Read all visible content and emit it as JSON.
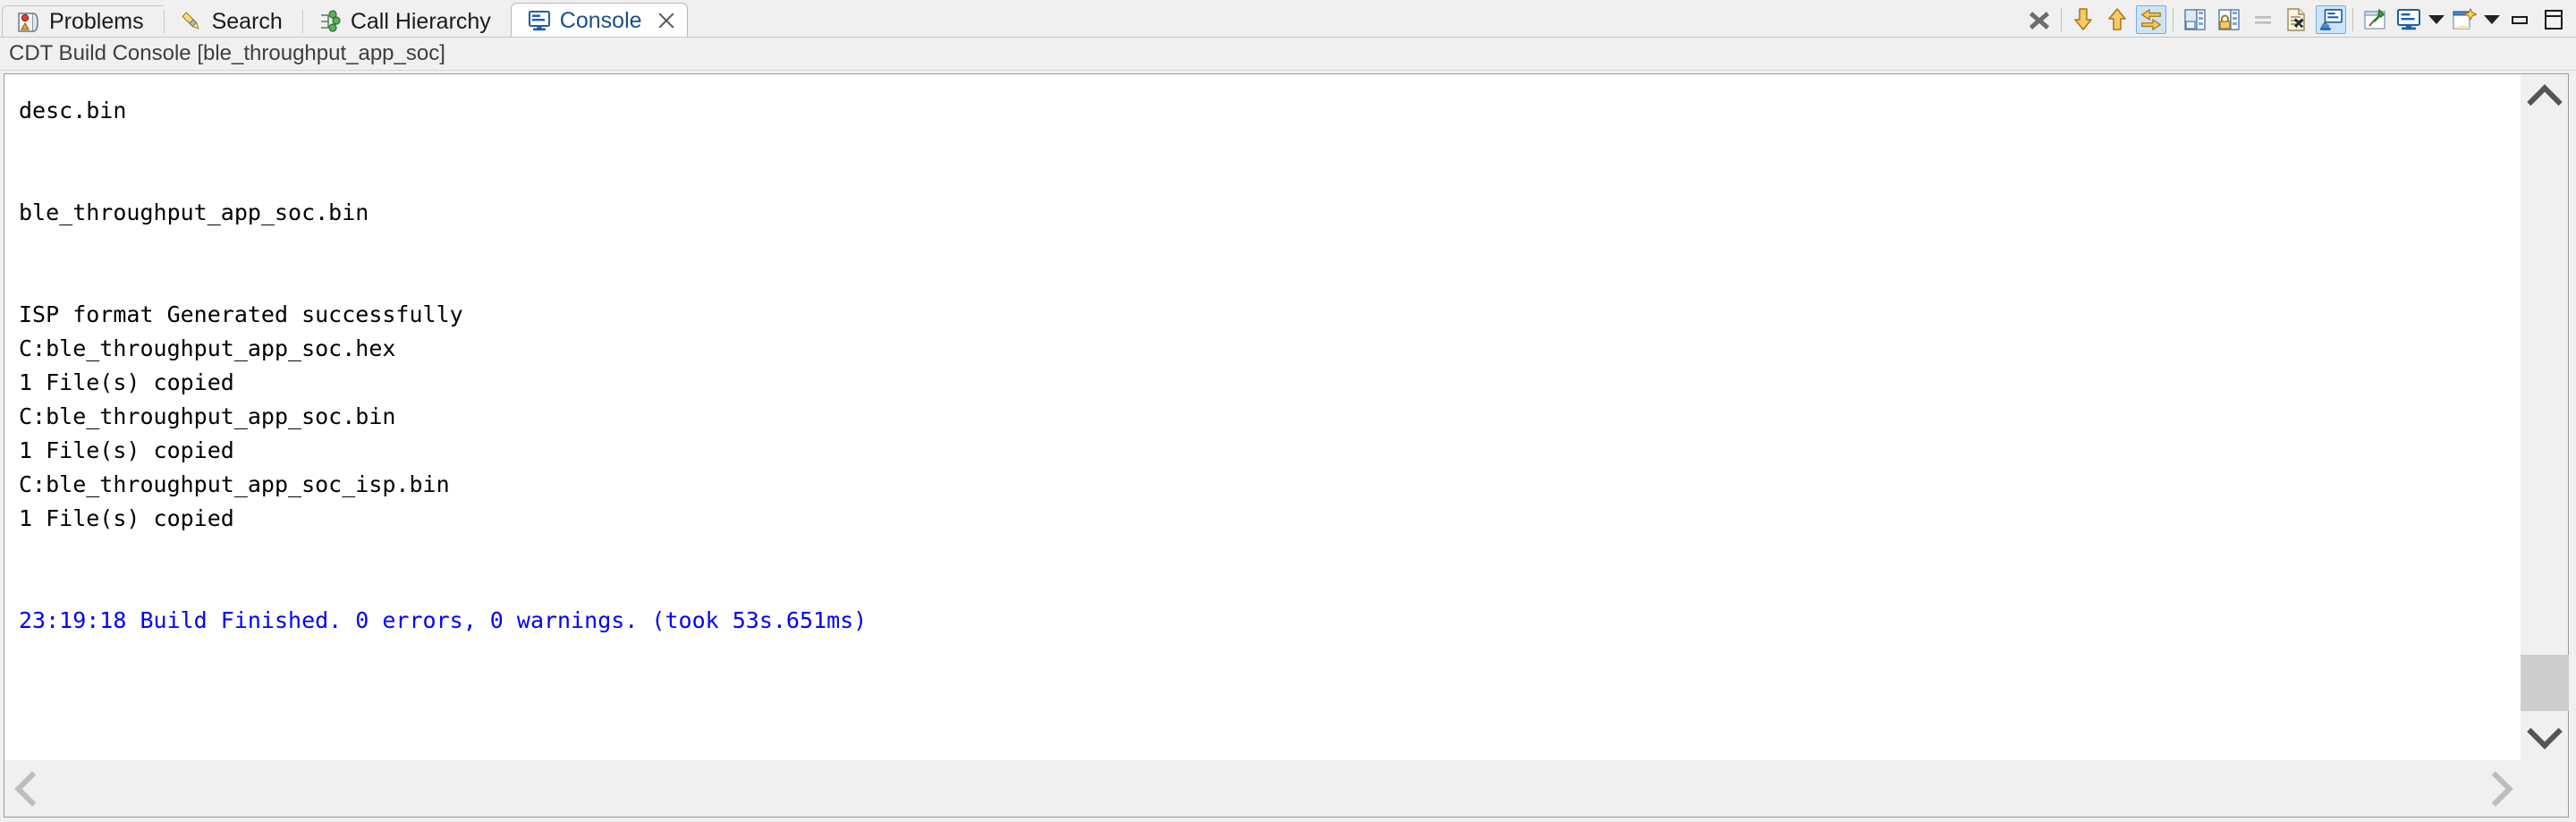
{
  "view": {
    "title": "CDT Build Console [ble_throughput_app_soc]"
  },
  "tabs": [
    {
      "label": "Problems",
      "icon": "problems-icon",
      "active": false,
      "closable": false
    },
    {
      "label": "Search",
      "icon": "search-icon",
      "active": false,
      "closable": false
    },
    {
      "label": "Call Hierarchy",
      "icon": "call-hierarchy-icon",
      "active": false,
      "closable": false
    },
    {
      "label": "Console",
      "icon": "console-icon",
      "active": true,
      "closable": true
    }
  ],
  "toolbar": {
    "items": [
      {
        "name": "terminate-button",
        "icon": "terminate-x-icon",
        "tooltip": "Terminate",
        "toggled": false
      },
      {
        "name": "separator-1",
        "icon": "separator",
        "tooltip": "",
        "toggled": false
      },
      {
        "name": "scroll-lock-down-button",
        "icon": "arrow-down-icon",
        "tooltip": "Scroll Lock",
        "toggled": false
      },
      {
        "name": "previous-button",
        "icon": "arrow-up-icon",
        "tooltip": "Previous",
        "toggled": false
      },
      {
        "name": "word-wrap-button",
        "icon": "wrap-arrows-icon",
        "tooltip": "Word Wrap",
        "toggled": true
      },
      {
        "name": "separator-2",
        "icon": "separator",
        "tooltip": "",
        "toggled": false
      },
      {
        "name": "clear-console-button",
        "icon": "clear-console-icon",
        "tooltip": "Clear Console",
        "toggled": false
      },
      {
        "name": "scroll-lock-button",
        "icon": "scroll-lock-icon",
        "tooltip": "Scroll Lock",
        "toggled": false
      },
      {
        "name": "equals-button",
        "icon": "equals-icon",
        "tooltip": "",
        "toggled": false
      },
      {
        "name": "remove-console-button",
        "icon": "remove-launch-icon",
        "tooltip": "Remove Launch",
        "toggled": false
      },
      {
        "name": "show-console-button",
        "icon": "show-console-icon",
        "tooltip": "Show Console When Output",
        "toggled": true
      },
      {
        "name": "separator-3",
        "icon": "separator",
        "tooltip": "",
        "toggled": false
      },
      {
        "name": "pin-console-button",
        "icon": "pin-icon",
        "tooltip": "Pin Console",
        "toggled": false
      },
      {
        "name": "display-selected-console-button",
        "icon": "display-console-icon",
        "tooltip": "Display Selected Console",
        "toggled": false
      },
      {
        "name": "display-console-menu-arrow",
        "icon": "chevron-down-icon",
        "tooltip": "",
        "toggled": false
      },
      {
        "name": "open-console-button",
        "icon": "new-console-icon",
        "tooltip": "Open Console",
        "toggled": false
      },
      {
        "name": "open-console-menu-arrow",
        "icon": "chevron-down-icon",
        "tooltip": "",
        "toggled": false
      },
      {
        "name": "minimize-view-button",
        "icon": "minimize-icon",
        "tooltip": "Minimize",
        "toggled": false
      },
      {
        "name": "maximize-view-button",
        "icon": "maximize-icon",
        "tooltip": "Maximize",
        "toggled": false
      }
    ]
  },
  "console": {
    "lines": [
      {
        "text": "desc.bin",
        "style": "normal"
      },
      {
        "text": "",
        "style": "blank"
      },
      {
        "text": "",
        "style": "blank"
      },
      {
        "text": "ble_throughput_app_soc.bin",
        "style": "normal"
      },
      {
        "text": "",
        "style": "blank"
      },
      {
        "text": "",
        "style": "blank"
      },
      {
        "text": "ISP format Generated successfully",
        "style": "normal"
      },
      {
        "text": "C:ble_throughput_app_soc.hex",
        "style": "normal"
      },
      {
        "text": "1 File(s) copied",
        "style": "normal"
      },
      {
        "text": "C:ble_throughput_app_soc.bin",
        "style": "normal"
      },
      {
        "text": "1 File(s) copied",
        "style": "normal"
      },
      {
        "text": "C:ble_throughput_app_soc_isp.bin",
        "style": "normal"
      },
      {
        "text": "1 File(s) copied",
        "style": "normal"
      },
      {
        "text": "",
        "style": "blank"
      },
      {
        "text": "",
        "style": "blank"
      },
      {
        "text": "23:19:18 Build Finished. 0 errors, 0 warnings. (took 53s.651ms)",
        "style": "info"
      }
    ]
  },
  "scrollbars": {
    "vertical": {
      "up_arrow": "chevron-up-icon",
      "down_arrow": "chevron-down-icon",
      "thumb_visible": true
    },
    "horizontal": {
      "left_arrow": "chevron-left-icon",
      "right_arrow": "chevron-right-icon",
      "thumb_visible": false
    }
  },
  "colors": {
    "info_text": "#0000ff",
    "normal_text": "#000000",
    "active_tab_text": "#1b4e8e",
    "panel_bg": "#f0f0f0",
    "console_bg": "#ffffff",
    "toggled_button_bg": "#cde3f7"
  }
}
